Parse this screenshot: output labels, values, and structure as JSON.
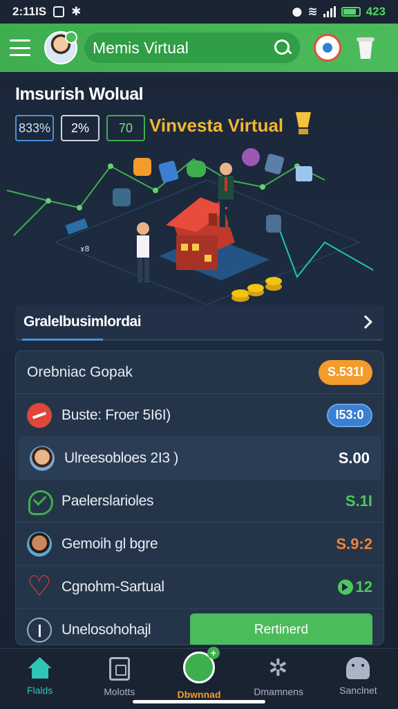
{
  "status_bar": {
    "time": "2:11IS",
    "battery_text": "423"
  },
  "app_bar": {
    "title": "Memis Virtual",
    "icons": [
      "menu-icon",
      "avatar",
      "search-icon",
      "share-badge-icon",
      "cup-icon"
    ]
  },
  "hero": {
    "title": "Imsurish Wolual",
    "chips": [
      "833%",
      "2%",
      "70"
    ],
    "brand": "Vinvesta Virtual",
    "illustration_text": "ɤ8"
  },
  "guide": {
    "label": "Gralelbusimlordai",
    "progress_fraction": 0.22
  },
  "list": {
    "header_title": "Orebniac Gopak",
    "header_badge": "S.531I",
    "rows": [
      {
        "label": "Buste: Froer 5I6I)",
        "value": "I53:0",
        "icon": "red-badge-icon",
        "style": "pill-blue"
      },
      {
        "label": "Ulreesobloes 2I3 )",
        "value": "S.00",
        "icon": "avatar-icon",
        "style": "white"
      },
      {
        "label": "Paelerslarioles",
        "value": "S.1I",
        "icon": "check-icon",
        "style": "green"
      },
      {
        "label": "Gemoih gl bgre",
        "value": "S.9:2",
        "icon": "avatar-icon",
        "style": "orange"
      },
      {
        "label": "Cgnohm-Sartual",
        "value": "12",
        "icon": "heart-icon",
        "style": "green-dot"
      }
    ],
    "footer_label": "Unelosohohajl",
    "footer_button": "Rertinerd"
  },
  "bottom_nav": {
    "items": [
      {
        "label": "Flalds",
        "icon": "home-icon"
      },
      {
        "label": "Molotts",
        "icon": "tablet-icon"
      },
      {
        "label": "Dbwnnad",
        "icon": "add-icon"
      },
      {
        "label": "Dmamnens",
        "icon": "sun-icon"
      },
      {
        "label": "Sanclnet",
        "icon": "ghost-icon"
      }
    ]
  },
  "colors": {
    "accent_green": "#4cbb5b",
    "accent_orange": "#f39c2b",
    "accent_blue": "#3b7fd1",
    "background": "#1d2b40"
  }
}
